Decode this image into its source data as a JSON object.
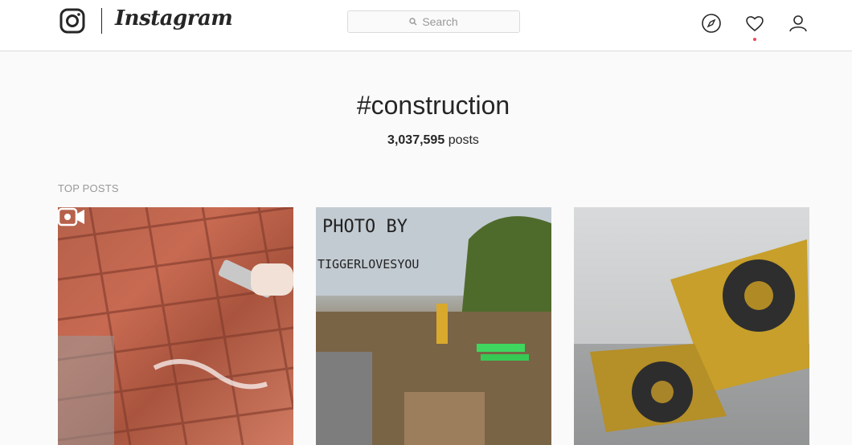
{
  "header": {
    "brand": "Instagram",
    "search": {
      "placeholder": "Search"
    },
    "icons": [
      "instagram-logo-icon",
      "search-icon",
      "compass-icon",
      "heart-icon",
      "profile-icon"
    ],
    "accent": "#ed4956"
  },
  "main": {
    "hashtag": "#construction",
    "post_count": "3,037,595",
    "post_suffix": "posts",
    "section_label": "TOP POSTS",
    "posts": [
      {
        "type": "video",
        "badge_icon": "video-camera-icon"
      },
      {
        "type": "photo",
        "overlay_line1": "PHOTO BY",
        "overlay_line2": "TIGGERLOVESYOU"
      },
      {
        "type": "photo"
      }
    ]
  }
}
